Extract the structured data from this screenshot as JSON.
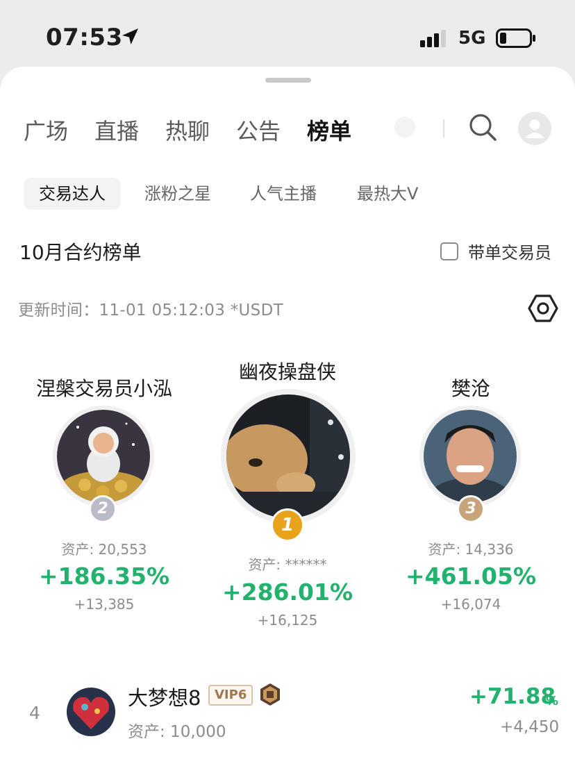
{
  "status_bar": {
    "time": "07:53",
    "network": "5G"
  },
  "tabs": [
    {
      "label": "广场",
      "active": false
    },
    {
      "label": "直播",
      "active": false
    },
    {
      "label": "热聊",
      "active": false
    },
    {
      "label": "公告",
      "active": false
    },
    {
      "label": "榜单",
      "active": true
    }
  ],
  "sub_tabs": [
    {
      "label": "交易达人",
      "active": true
    },
    {
      "label": "涨粉之星",
      "active": false
    },
    {
      "label": "人气主播",
      "active": false
    },
    {
      "label": "最热大V",
      "active": false
    }
  ],
  "section": {
    "title": "10月合约榜单",
    "checkbox_label": "带单交易员",
    "checkbox_checked": false,
    "update_text": "更新时间：11-01 05:12:03  *USDT"
  },
  "podium": {
    "second": {
      "rank": "2",
      "name": "涅槃交易员小泓",
      "asset": "资产: 20,553",
      "percent": "+186.35%",
      "pnl": "+13,385"
    },
    "first": {
      "rank": "1",
      "name": "幽夜操盘侠",
      "asset": "资产: ******",
      "percent": "+286.01%",
      "pnl": "+16,125"
    },
    "third": {
      "rank": "3",
      "name": "樊沧",
      "asset": "资产: 14,336",
      "percent": "+461.05%",
      "pnl": "+16,074"
    }
  },
  "list": [
    {
      "rank": "4",
      "name": "大梦想8",
      "vip": "VIP6",
      "asset": "资产: 10,000",
      "percent": "+71.88",
      "percent_sign": "%",
      "pnl": "+4,450"
    }
  ],
  "colors": {
    "gain": "#23b26d",
    "gold": "#e9a21b",
    "silver": "#b9bcc6",
    "bronze": "#c8a47a"
  },
  "icons": [
    "location-arrow-icon",
    "signal-icon",
    "battery-icon",
    "search-icon",
    "user-avatar-icon",
    "settings-icon",
    "badge-icon"
  ]
}
